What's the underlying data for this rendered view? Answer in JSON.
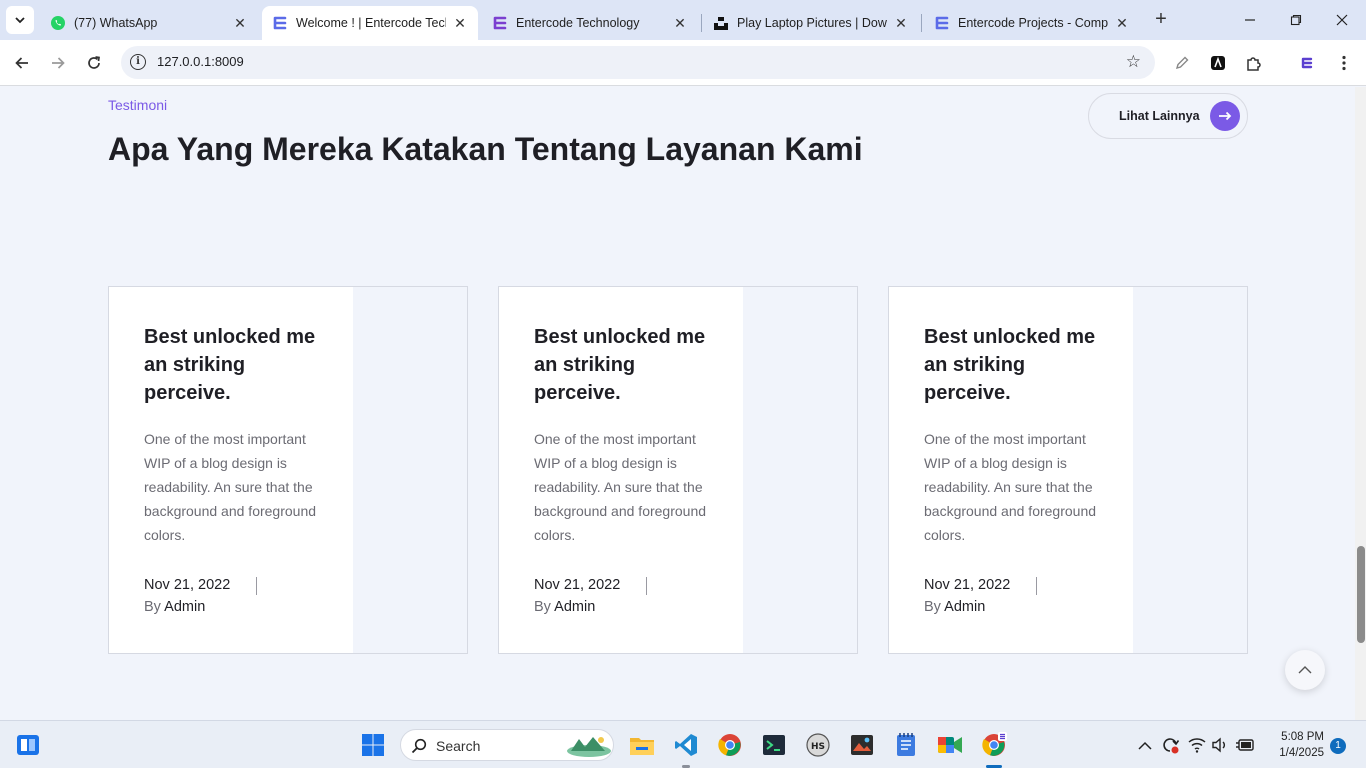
{
  "browser": {
    "tabs": [
      {
        "title": "(77) WhatsApp",
        "active": false,
        "icon": "whatsapp-icon"
      },
      {
        "title": "Welcome ! | Entercode Techr",
        "active": true,
        "icon": "entercode-icon"
      },
      {
        "title": "Entercode Technology",
        "active": false,
        "icon": "entercode-icon"
      },
      {
        "title": "Play Laptop Pictures | Downl",
        "active": false,
        "icon": "unsplash-icon"
      },
      {
        "title": "Entercode Projects - Compa",
        "active": false,
        "icon": "entercode-icon"
      }
    ],
    "url": "127.0.0.1:8009"
  },
  "section": {
    "eyebrow": "Testimoni",
    "heading": "Apa Yang Mereka Katakan Tentang Layanan Kami",
    "more_label": "Lihat Lainnya"
  },
  "cards": [
    {
      "title": "Best unlocked me an striking perceive.",
      "body": "One of the most important WIP of a blog design is readability. An sure that the background and foreground colors.",
      "date": "Nov 21, 2022",
      "by": "By",
      "author": "Admin"
    },
    {
      "title": "Best unlocked me an striking perceive.",
      "body": "One of the most important WIP of a blog design is readability. An sure that the background and foreground colors.",
      "date": "Nov 21, 2022",
      "by": "By",
      "author": "Admin"
    },
    {
      "title": "Best unlocked me an striking perceive.",
      "body": "One of the most important WIP of a blog design is readability. An sure that the background and foreground colors.",
      "date": "Nov 21, 2022",
      "by": "By",
      "author": "Admin"
    }
  ],
  "taskbar": {
    "search_label": "Search",
    "time": "5:08 PM",
    "date": "1/4/2025",
    "notification_count": "1"
  },
  "colors": {
    "accent": "#7b5ae6",
    "page_bg": "#f1f4fb",
    "heading": "#1f1f25"
  }
}
